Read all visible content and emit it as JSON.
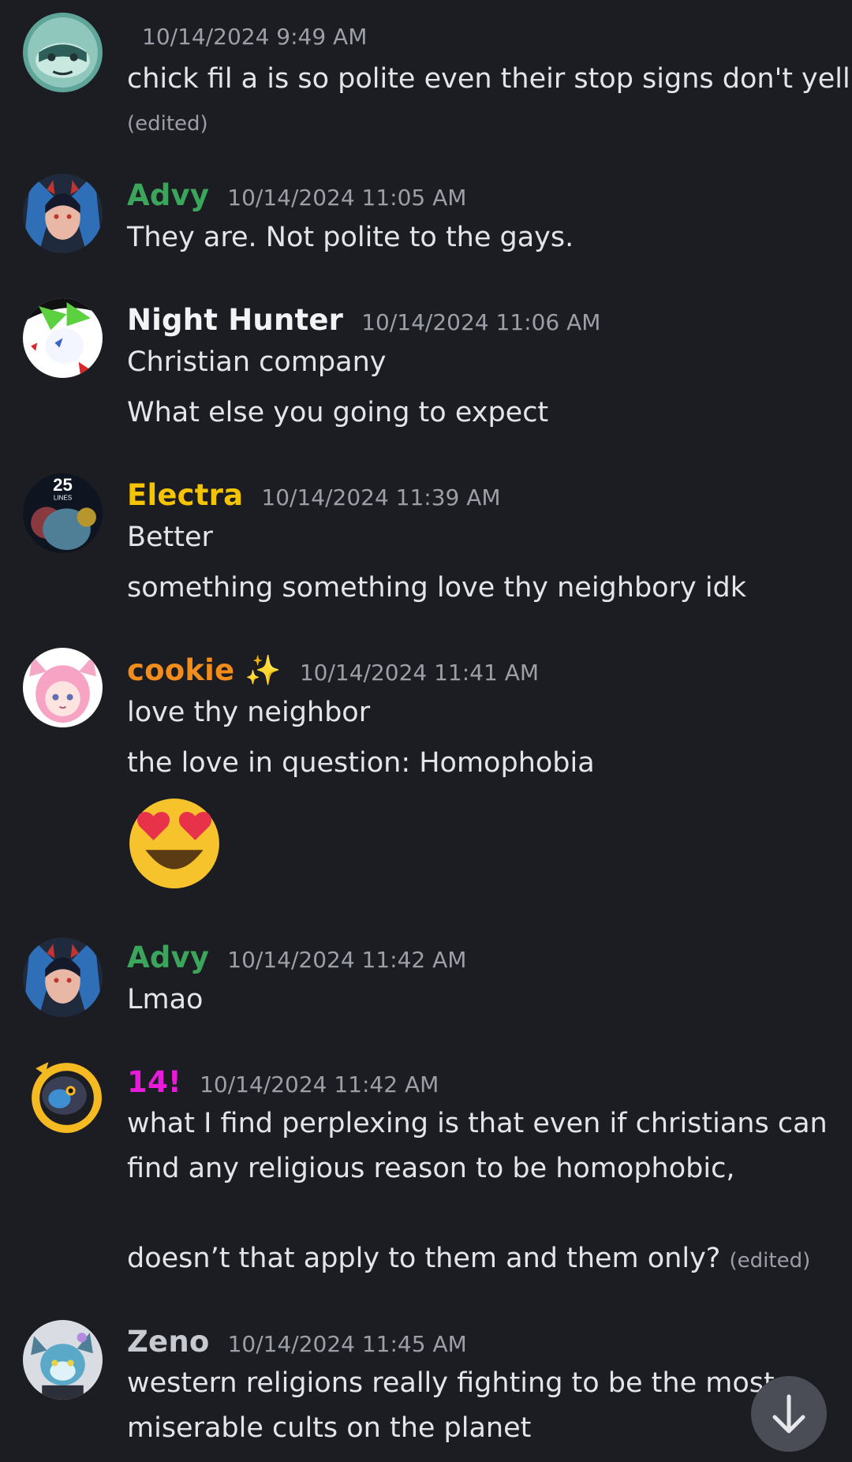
{
  "messages": [
    {
      "username": "",
      "timestamp": "10/14/2024 9:49 AM",
      "lines": [
        "chick fil a is so polite even their stop signs don't yell"
      ],
      "edited_label": "(edited)"
    },
    {
      "username": "Advy",
      "timestamp": "10/14/2024 11:05 AM",
      "lines": [
        "They are. Not polite to the gays."
      ]
    },
    {
      "username": "Night Hunter",
      "timestamp": "10/14/2024 11:06 AM",
      "lines": [
        "Christian company",
        "What else you going to expect"
      ]
    },
    {
      "username": "Electra",
      "timestamp": "10/14/2024 11:39 AM",
      "lines": [
        "Better",
        "something something love thy neighbory idk"
      ],
      "avatar_badge": "25",
      "avatar_badge_sub": "LINES"
    },
    {
      "username": "cookie ✨",
      "timestamp": "10/14/2024 11:41 AM",
      "lines": [
        "love thy neighbor",
        "the love in question: Homophobia"
      ],
      "emoji": "heart-eyes-emoji"
    },
    {
      "username": "Advy",
      "timestamp": "10/14/2024 11:42 AM",
      "lines": [
        "Lmao"
      ]
    },
    {
      "username": "14!",
      "timestamp": "10/14/2024 11:42 AM",
      "lines": [
        "what I find perplexing is that even if christians can",
        "find any religious reason to be homophobic,",
        "doesn’t that apply to them and them only?"
      ],
      "edited_label": "(edited)"
    },
    {
      "username": "Zeno",
      "timestamp": "10/14/2024 11:45 AM",
      "lines": [
        "western religions really fighting to be the most",
        "miserable cults on the planet"
      ]
    }
  ],
  "colors": {
    "background": "#1c1d22",
    "advy": "#3ba55c",
    "night_hunter": "#f2f3f5",
    "electra": "#f5c400",
    "cookie": "#f28c1a",
    "fourteen": "#e91ad9",
    "zeno": "#c7cad1",
    "timestamp": "#9c9fa8"
  },
  "scroll_button": {
    "icon": "arrow-down-icon"
  }
}
